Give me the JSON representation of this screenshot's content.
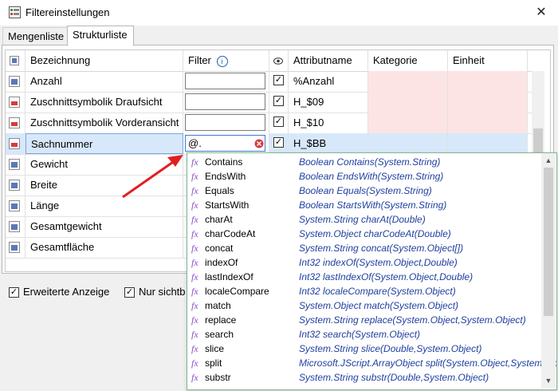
{
  "window": {
    "title": "Filtereinstellungen",
    "close_symbol": "✕"
  },
  "tabs": [
    {
      "label": "Mengenliste"
    },
    {
      "label": "Strukturliste"
    }
  ],
  "grid": {
    "headers": {
      "name": "Bezeichnung",
      "filter": "Filter",
      "visibility_icon": "eye-icon",
      "attribute": "Attributname",
      "category": "Kategorie",
      "unit": "Einheit"
    },
    "rows": [
      {
        "name": "Anzahl",
        "filter": "",
        "checked": true,
        "attribute": "%Anzahl"
      },
      {
        "name": "Zuschnittsymbolik Draufsicht",
        "filter": "",
        "checked": true,
        "attribute": "H_$09"
      },
      {
        "name": "Zuschnittsymbolik Vorderansicht",
        "filter": "",
        "checked": true,
        "attribute": "H_$10"
      },
      {
        "name": "Sachnummer",
        "filter": "@.",
        "checked": true,
        "attribute": "H_$BB"
      },
      {
        "name": "Gewicht"
      },
      {
        "name": "Breite"
      },
      {
        "name": "Länge"
      },
      {
        "name": "Gesamtgewicht"
      },
      {
        "name": "Gesamtfläche"
      }
    ]
  },
  "options": {
    "extended_view": "Erweiterte Anzeige",
    "only_visible": "Nur sichtb"
  },
  "autocomplete": {
    "items": [
      {
        "name": "Contains",
        "signature": "Boolean Contains(System.String)"
      },
      {
        "name": "EndsWith",
        "signature": "Boolean EndsWith(System.String)"
      },
      {
        "name": "Equals",
        "signature": "Boolean Equals(System.String)"
      },
      {
        "name": "StartsWith",
        "signature": "Boolean StartsWith(System.String)"
      },
      {
        "name": "charAt",
        "signature": "System.String charAt(Double)"
      },
      {
        "name": "charCodeAt",
        "signature": "System.Object charCodeAt(Double)"
      },
      {
        "name": "concat",
        "signature": "System.String concat(System.Object[])"
      },
      {
        "name": "indexOf",
        "signature": "Int32 indexOf(System.Object,Double)"
      },
      {
        "name": "lastIndexOf",
        "signature": "Int32 lastIndexOf(System.Object,Double)"
      },
      {
        "name": "localeCompare",
        "signature": "Int32 localeCompare(System.Object)"
      },
      {
        "name": "match",
        "signature": "System.Object match(System.Object)"
      },
      {
        "name": "replace",
        "signature": "System.String replace(System.Object,System.Object)"
      },
      {
        "name": "search",
        "signature": "Int32 search(System.Object)"
      },
      {
        "name": "slice",
        "signature": "System.String slice(Double,System.Object)"
      },
      {
        "name": "split",
        "signature": "Microsoft.JScript.ArrayObject split(System.Object,System.Ob"
      },
      {
        "name": "substr",
        "signature": "System.String substr(Double,System.Object)"
      }
    ]
  },
  "colors": {
    "pink_cell": "#fce4e4",
    "selected_row": "#d7e8fb",
    "signature": "#1f3fa0",
    "fx_icon": "#8a4ec7",
    "arrow": "#e02020"
  }
}
